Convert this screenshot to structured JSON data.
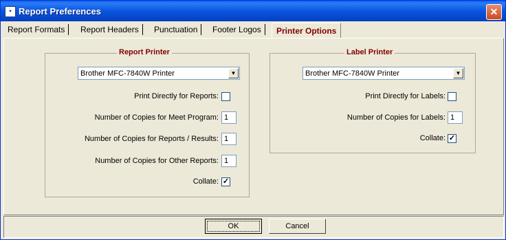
{
  "window": {
    "title": "Report Preferences",
    "close_glyph": "✕",
    "app_icon": "app-icon"
  },
  "tabs": [
    {
      "label": "Report Formats"
    },
    {
      "label": "Report Headers"
    },
    {
      "label": "Punctuation"
    },
    {
      "label": "Footer Logos"
    },
    {
      "label": "Printer Options"
    }
  ],
  "report_printer": {
    "title": "Report Printer",
    "printer_value": "Brother MFC-7840W Printer",
    "print_directly_label": "Print Directly for Reports:",
    "print_directly_checked": "",
    "meet_program_label": "Number of Copies for Meet Program:",
    "meet_program_copies": "1",
    "reports_results_label": "Number of Copies for Reports / Results:",
    "reports_results_copies": "1",
    "other_reports_label": "Number of Copies for Other Reports:",
    "other_reports_copies": "1",
    "collate_label": "Collate:",
    "collate_checked": "✓"
  },
  "label_printer": {
    "title": "Label Printer",
    "printer_value": "Brother MFC-7840W Printer",
    "print_directly_label": "Print Directly for Labels:",
    "print_directly_checked": "",
    "copies_label": "Number of Copies for Labels:",
    "copies": "1",
    "collate_label": "Collate:",
    "collate_checked": "✓"
  },
  "buttons": {
    "ok": "OK",
    "cancel": "Cancel"
  },
  "colors": {
    "accent": "#800000",
    "titlebar": "#0A5FE6",
    "face": "#ECE9D8"
  }
}
